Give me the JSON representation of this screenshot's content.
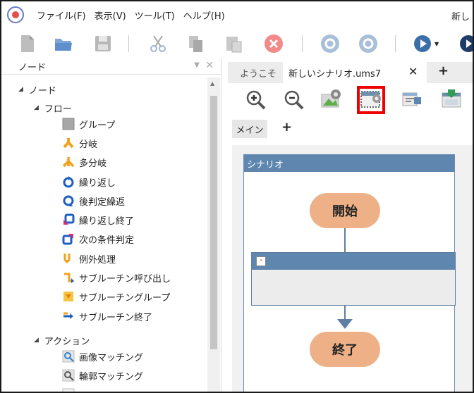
{
  "menu": {
    "file": "ファイル(F)",
    "view": "表示(V)",
    "tools": "ツール(T)",
    "help": "ヘルプ(H)",
    "title": "新し"
  },
  "toolbar": {
    "icons": [
      "new-file-icon",
      "open-folder-icon",
      "save-icon",
      "cut-icon",
      "copy-icon",
      "paste-icon",
      "delete-icon",
      "undo-icon",
      "redo-icon",
      "run-icon",
      "stop-icon"
    ]
  },
  "panel": {
    "title": "ノード",
    "root": "ノード",
    "flow": {
      "label": "フロー",
      "items": [
        "グループ",
        "分岐",
        "多分岐",
        "繰り返し",
        "後判定繰返",
        "繰り返し終了",
        "次の条件判定",
        "例外処理",
        "サブルーチン呼び出し",
        "サブルーチングループ",
        "サブルーチン終了"
      ]
    },
    "action": {
      "label": "アクション",
      "items": [
        "画像マッチング",
        "輪郭マッチング"
      ]
    }
  },
  "tabs": {
    "welcome": "ようこそ",
    "active": "新しいシナリオ.ums7",
    "close": "✕",
    "add": "+"
  },
  "subtabs": {
    "main": "メイン",
    "add": "+"
  },
  "scenario": {
    "title": "シナリオ",
    "start": "開始",
    "end": "終了",
    "collapse": "-"
  },
  "colors": {
    "highlight": "#ee0000",
    "node_fill": "#eeb187",
    "header_blue": "#5f86ae"
  }
}
